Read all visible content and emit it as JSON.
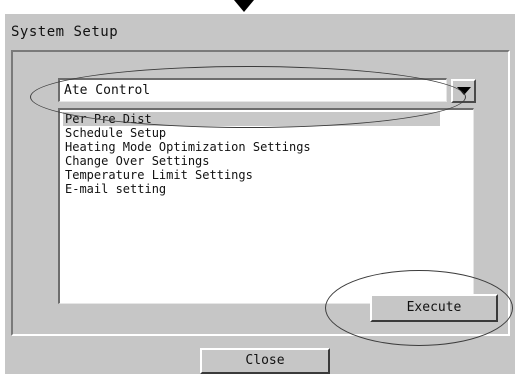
{
  "dialog": {
    "title": "System Setup"
  },
  "combo": {
    "value": "Ate Control"
  },
  "list": {
    "items": [
      {
        "label": "Per Pre Dist",
        "selected": true
      },
      {
        "label": "Schedule Setup",
        "selected": false
      },
      {
        "label": "Heating Mode Optimization Settings",
        "selected": false
      },
      {
        "label": "Change Over Settings",
        "selected": false
      },
      {
        "label": "Temperature Limit Settings",
        "selected": false
      },
      {
        "label": "E-mail setting",
        "selected": false
      }
    ]
  },
  "buttons": {
    "execute_label": "Execute",
    "close_label": "Close"
  },
  "icons": {
    "combo_dropdown": "chevron-down-icon",
    "top_marker": "arrow-down-icon"
  },
  "colors": {
    "panel": "#c6c6c6",
    "selection": "#c8c8c8",
    "annotation": "#3c3c3c"
  }
}
